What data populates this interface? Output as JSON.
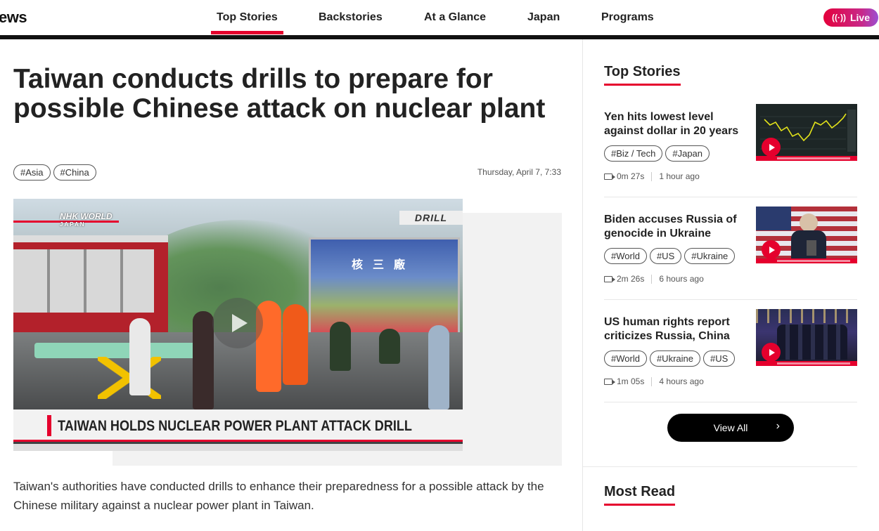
{
  "header": {
    "logo": "ews",
    "nav": [
      "Top Stories",
      "Backstories",
      "At a Glance",
      "Japan",
      "Programs"
    ],
    "live_label": "Live"
  },
  "article": {
    "headline": "Taiwan conducts drills to prepare for possible Chinese attack on nuclear plant",
    "tags": [
      "#Asia",
      "#China"
    ],
    "date": "Thursday, April 7, 7:33",
    "video": {
      "channel_logo": "NHK WORLD",
      "channel_sub": "JAPAN",
      "badge": "DRILL",
      "billboard_text": "核三廠",
      "caption": "TAIWAN HOLDS NUCLEAR POWER PLANT ATTACK DRILL"
    },
    "summary": "Taiwan's authorities have conducted drills to enhance their preparedness for a possible attack by the Chinese military against a nuclear power plant in Taiwan."
  },
  "sidebar": {
    "top_stories_heading": "Top Stories",
    "stories": [
      {
        "title": "Yen hits lowest level against dollar in 20 years",
        "tags": [
          "#Biz / Tech",
          "#Japan"
        ],
        "duration": "0m 27s",
        "time": "1 hour ago"
      },
      {
        "title": "Biden accuses Russia of genocide in Ukraine",
        "tags": [
          "#World",
          "#US",
          "#Ukraine"
        ],
        "duration": "2m 26s",
        "time": "6 hours ago"
      },
      {
        "title": "US human rights report criticizes Russia, China",
        "tags": [
          "#World",
          "#Ukraine",
          "#US"
        ],
        "duration": "1m 05s",
        "time": "4 hours ago"
      }
    ],
    "view_all_label": "View All",
    "most_read_heading": "Most Read"
  }
}
